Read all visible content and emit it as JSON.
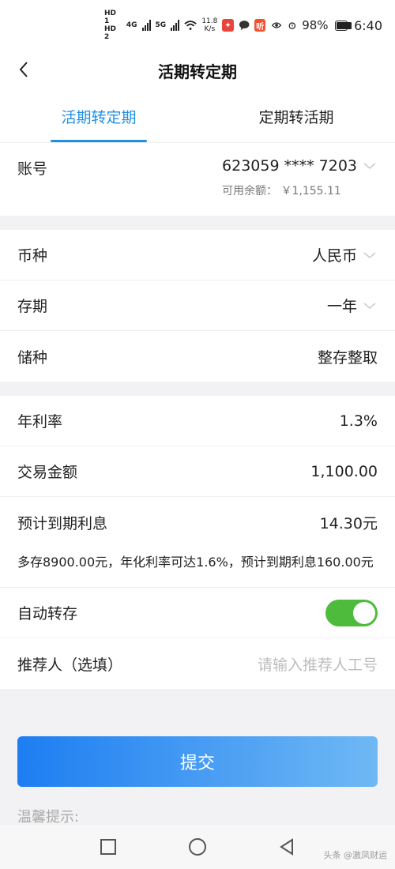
{
  "status": {
    "hd1": "HD 1",
    "hd2": "HD 2",
    "net1": "4G",
    "net2": "5G",
    "speed_value": "11.8",
    "speed_unit": "K/s",
    "app_badge": "听",
    "battery": "98%",
    "battery_level": 0.98,
    "time": "6:40"
  },
  "nav": {
    "title": "活期转定期",
    "back_icon": "chevron-left-icon"
  },
  "tabs": [
    {
      "label": "活期转定期",
      "active": true
    },
    {
      "label": "定期转活期",
      "active": false
    }
  ],
  "account": {
    "label": "账号",
    "number": "623059 **** 7203",
    "balance_label": "可用余额：",
    "balance_value": "￥1,155.11"
  },
  "deposit": {
    "currency_label": "币种",
    "currency_value": "人民币",
    "term_label": "存期",
    "term_value": "一年",
    "type_label": "储种",
    "type_value": "整存整取"
  },
  "details": {
    "rate_label": "年利率",
    "rate_value": "1.3%",
    "amount_label": "交易金额",
    "amount_value": "1,100.00",
    "interest_label": "预计到期利息",
    "interest_value": "14.30元",
    "promo": "多存8900.00元，年化利率可达1.6%，预计到期利息160.00元",
    "auto_label": "自动转存",
    "auto_on": true,
    "referrer_label": "推荐人（选填）",
    "referrer_placeholder": "请输入推荐人工号"
  },
  "submit_label": "提交",
  "tip_label": "温馨提示:",
  "watermark": "头条 @激凤财运",
  "colors": {
    "accent": "#1f8fe6",
    "toggle_on": "#4fbb3c",
    "button_start": "#1d7ef2",
    "button_end": "#6fb8f4"
  }
}
